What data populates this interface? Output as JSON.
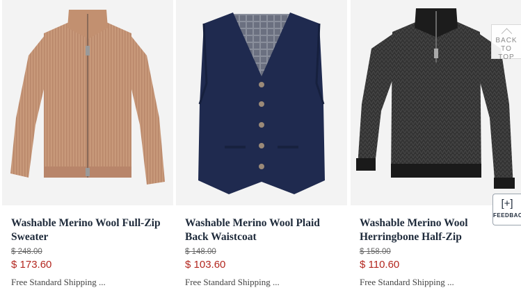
{
  "products": [
    {
      "title": "Washable Merino Wool Full-Zip Sweater",
      "old_price": "$ 248.00",
      "price": "$ 173.60",
      "shipping": "Free Standard Shipping ..."
    },
    {
      "title": "Washable Merino Wool Plaid Back Waistcoat",
      "old_price": "$ 148.00",
      "price": "$ 103.60",
      "shipping": "Free Standard Shipping ..."
    },
    {
      "title": "Washable Merino Wool Herringbone Half-Zip",
      "old_price": "$ 158.00",
      "price": "$ 110.60",
      "shipping": "Free Standard Shipping ..."
    }
  ],
  "back_to_top": {
    "line1": "BACK",
    "line2": "TO TOP"
  },
  "feedback": {
    "plus": "[+]",
    "label": "FEEDBACK"
  },
  "colors": {
    "title": "#1e2a3a",
    "sale_price": "#b3261e",
    "camel_sweater": "#c8997a",
    "navy_vest": "#1f2a4f",
    "charcoal_halfzip": "#2e2e2e"
  }
}
